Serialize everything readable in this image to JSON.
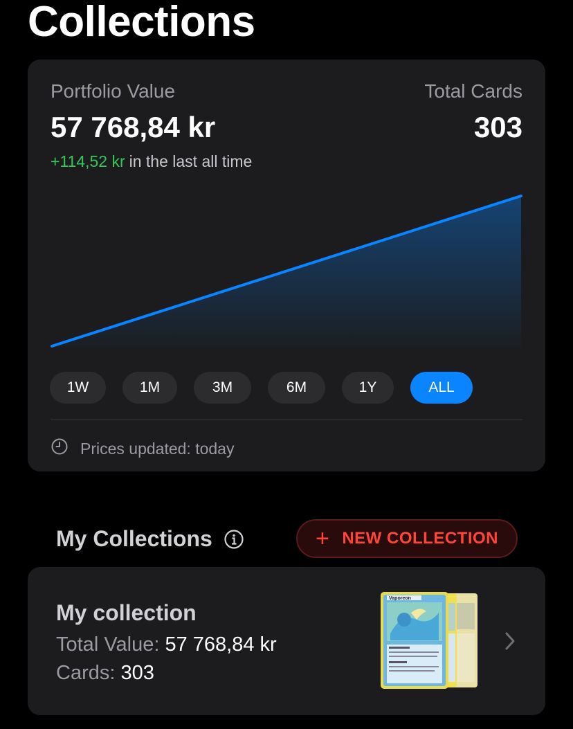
{
  "page": {
    "title": "Collections"
  },
  "portfolio": {
    "value_label": "Portfolio Value",
    "value": "57 768,84 kr",
    "cards_label": "Total Cards",
    "cards": "303",
    "change_amount": "+114,52 kr",
    "change_suffix": "in the last all time",
    "chart_color": "#0a84ff",
    "chart_data": {
      "type": "area",
      "title": "",
      "series": [
        {
          "values": [
            57654.32,
            57768.84
          ]
        }
      ],
      "trend": "linear increase"
    },
    "periods": [
      {
        "label": "1W",
        "active": false
      },
      {
        "label": "1M",
        "active": false
      },
      {
        "label": "3M",
        "active": false
      },
      {
        "label": "6M",
        "active": false
      },
      {
        "label": "1Y",
        "active": false
      },
      {
        "label": "ALL",
        "active": true
      }
    ],
    "updated_icon": "clock-icon",
    "updated_text": "Prices updated: today"
  },
  "collections": {
    "section_title": "My Collections",
    "info_icon": "info-icon",
    "new_button_label": "NEW COLLECTION",
    "new_button_icon": "plus-icon",
    "accent_color": "#ff453a",
    "items": [
      {
        "name": "My collection",
        "value_label": "Total Value:",
        "value": "57 768,84 kr",
        "cards_label": "Cards:",
        "cards": "303",
        "thumbnail": "card-stack-thumbnail",
        "card_name": "Vaporeon"
      }
    ]
  }
}
